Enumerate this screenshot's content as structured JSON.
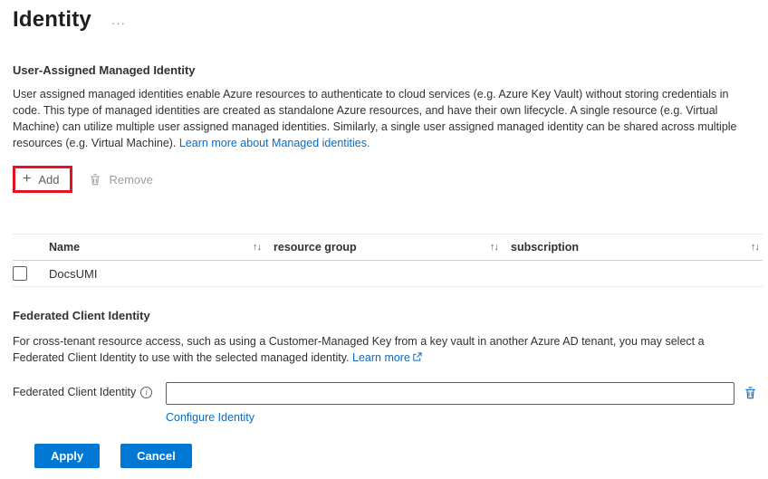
{
  "page": {
    "title": "Identity"
  },
  "icons": {
    "ellipsis": "···",
    "add_plus": "+",
    "sort": "↑↓",
    "info": "i"
  },
  "colors": {
    "accent": "#0078d4",
    "annotation": "#e81123",
    "link": "#0b6bc2"
  },
  "uami": {
    "heading": "User-Assigned Managed Identity",
    "description": "User assigned managed identities enable Azure resources to authenticate to cloud services (e.g. Azure Key Vault) without storing credentials in code. This type of managed identities are created as standalone Azure resources, and have their own lifecycle. A single resource (e.g. Virtual Machine) can utilize multiple user assigned managed identities. Similarly, a single user assigned managed identity can be shared across multiple resources (e.g. Virtual Machine).",
    "learn_more_label": "Learn more about Managed identities.",
    "toolbar": {
      "add_label": "Add",
      "remove_label": "Remove"
    },
    "table": {
      "columns": [
        "Name",
        "resource group",
        "subscription"
      ],
      "rows": [
        {
          "name": "DocsUMI"
        }
      ]
    }
  },
  "fci": {
    "heading": "Federated Client Identity",
    "description": "For cross-tenant resource access, such as using a Customer-Managed Key from a key vault in another Azure AD tenant, you may select a Federated Client Identity to use with the selected managed identity.",
    "learn_more_label": "Learn more",
    "field_label": "Federated Client Identity",
    "input_value": "",
    "configure_label": "Configure Identity"
  },
  "actions": {
    "apply_label": "Apply",
    "cancel_label": "Cancel"
  }
}
